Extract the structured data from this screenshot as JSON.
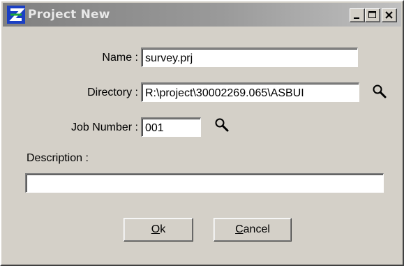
{
  "window": {
    "title": "Project New",
    "controls": [
      "minimize-icon",
      "maximize-icon",
      "close-icon"
    ]
  },
  "form": {
    "name_label": "Name :",
    "name_value": "survey.prj",
    "directory_label": "Directory :",
    "directory_value": "R:\\project\\30002269.065\\ASBUI",
    "job_number_label": "Job Number :",
    "job_number_value": "001",
    "description_label": "Description :",
    "description_value": ""
  },
  "buttons": {
    "ok_accel": "O",
    "ok_rest": "k",
    "cancel_accel": "C",
    "cancel_rest": "ancel"
  },
  "icons": {
    "app": "app-logo-icon",
    "browse": "magnifier-icon"
  },
  "colors": {
    "dialog_bg": "#d4d0c8",
    "title_gradient_start": "#808080",
    "title_gradient_end": "#c0c0c0",
    "logo_blue": "#1a3fc4",
    "logo_green": "#1fa83a"
  }
}
